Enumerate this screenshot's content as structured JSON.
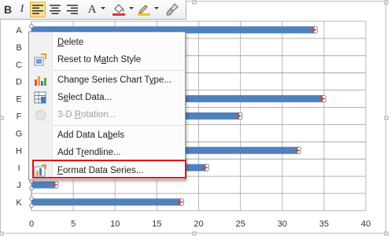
{
  "toolbar": {
    "buttons": [
      {
        "name": "bold",
        "glyph": "B",
        "active": false
      },
      {
        "name": "italic",
        "glyph": "I",
        "active": false
      },
      {
        "name": "align-left",
        "glyph": "",
        "active": true
      },
      {
        "name": "align-center",
        "glyph": "",
        "active": false
      },
      {
        "name": "align-right",
        "glyph": "",
        "active": false
      },
      {
        "name": "font-color",
        "glyph": "A",
        "active": false
      },
      {
        "name": "fill",
        "glyph": "",
        "active": false
      },
      {
        "name": "outline",
        "glyph": "",
        "active": false
      },
      {
        "name": "format-painter",
        "glyph": "",
        "active": false
      }
    ],
    "colors": {
      "fill": "#e53434",
      "outline": "#f5c518"
    }
  },
  "context_menu": {
    "items": [
      {
        "label": "Delete",
        "accel": "D",
        "icon": "none",
        "disabled": false
      },
      {
        "label": "Reset to Match Style",
        "accel": "a",
        "icon": "reset-style-icon",
        "disabled": false
      },
      {
        "label": "Change Series Chart Type...",
        "accel": "Y",
        "icon": "chart-type-icon",
        "disabled": false
      },
      {
        "label": "Select Data...",
        "accel": "e",
        "icon": "select-data-icon",
        "disabled": false
      },
      {
        "label": "3-D Rotation...",
        "accel": "R",
        "icon": "rotation-icon",
        "disabled": true
      },
      {
        "label": "Add Data Labels",
        "accel": "b",
        "icon": "none",
        "disabled": false
      },
      {
        "label": "Add Trendline...",
        "accel": "r",
        "icon": "none",
        "disabled": false
      },
      {
        "label": "Format Data Series...",
        "accel": "F",
        "icon": "format-series-icon",
        "disabled": false
      }
    ],
    "highlighted": "Format Data Series..."
  },
  "chart_data": {
    "type": "bar",
    "orientation": "horizontal",
    "categories": [
      "A",
      "B",
      "C",
      "D",
      "E",
      "F",
      "G",
      "H",
      "I",
      "J",
      "K"
    ],
    "values": [
      34,
      null,
      null,
      null,
      35,
      25,
      null,
      32,
      21,
      3,
      18
    ],
    "xlim": [
      0,
      40
    ],
    "xticks": [
      0,
      5,
      10,
      15,
      20,
      25,
      30,
      35,
      40
    ],
    "grid": "vertical",
    "series_color": "#4f81bd",
    "end_marker_color": "#c0504d",
    "title": "",
    "xlabel": "",
    "ylabel": ""
  }
}
